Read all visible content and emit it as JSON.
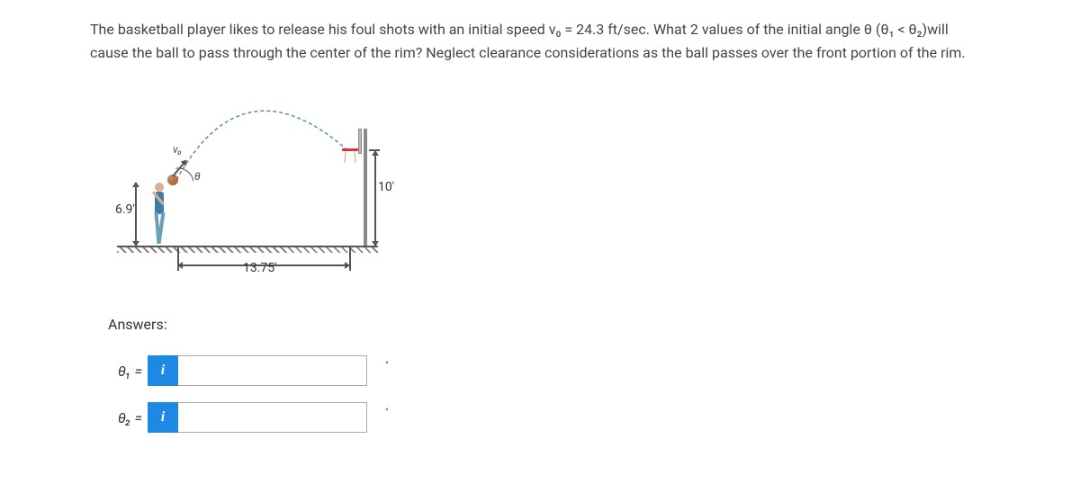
{
  "problem": {
    "text": "The basketball player likes to release his foul shots with an initial speed v₀ = 24.3 ft/sec. What 2 values of the initial angle θ (θ₁ < θ₂)will cause the ball to pass through the center of the rim? Neglect clearance considerations as the ball passes over the front portion of the rim."
  },
  "figure": {
    "v0_label": "v₀",
    "theta_label": "θ",
    "release_height": "6.9'",
    "rim_height": "10'",
    "horizontal_distance": "13.75'"
  },
  "answers": {
    "heading": "Answers:",
    "theta1_label": "θ₁ =",
    "theta1_value": "",
    "theta2_label": "θ₂ =",
    "theta2_value": "",
    "unit": "°",
    "info_symbol": "i"
  }
}
